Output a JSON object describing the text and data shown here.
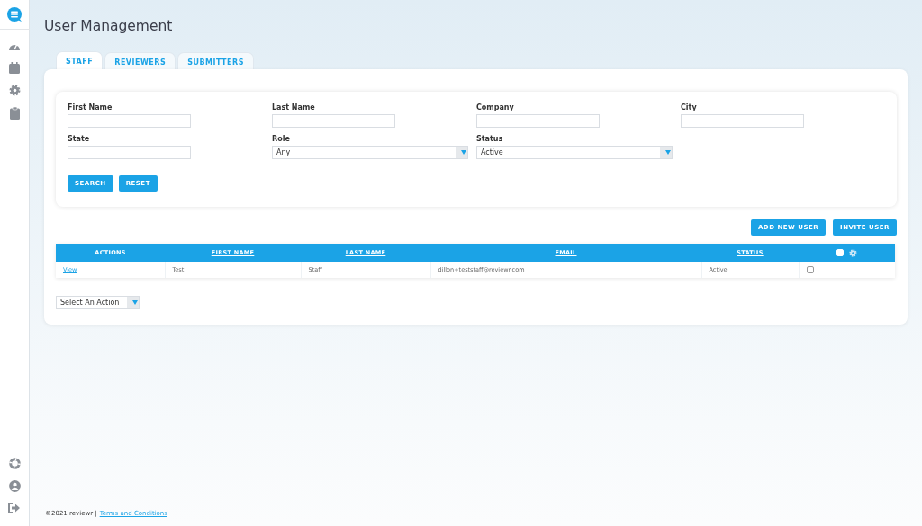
{
  "page_title": "User Management",
  "tabs": [
    {
      "label": "STAFF",
      "selected": true
    },
    {
      "label": "REVIEWERS",
      "selected": false
    },
    {
      "label": "SUBMITTERS",
      "selected": false
    }
  ],
  "filters": [
    {
      "kind": "text",
      "label": "First Name"
    },
    {
      "kind": "text",
      "label": "Last Name"
    },
    {
      "kind": "text",
      "label": "Company"
    },
    {
      "kind": "text",
      "label": "City"
    },
    {
      "kind": "text",
      "label": "State"
    },
    {
      "kind": "select",
      "label": "Role",
      "value": "Any"
    },
    {
      "kind": "select",
      "label": "Status",
      "value": "Active"
    }
  ],
  "filter_buttons": [
    "SEARCH",
    "RESET"
  ],
  "action_buttons": [
    "ADD NEW USER",
    "INVITE USER"
  ],
  "table": {
    "columns": [
      {
        "label": "ACTIONS",
        "sortable": false
      },
      {
        "label": "FIRST NAME",
        "sortable": true
      },
      {
        "label": "LAST NAME",
        "sortable": true
      },
      {
        "label": "EMAIL",
        "sortable": true
      },
      {
        "label": "STATUS",
        "sortable": true
      }
    ],
    "select_all": {
      "checked": false
    },
    "rows": [
      {
        "action": "View",
        "first_name": "Test",
        "last_name": "Staff",
        "email": "dillon+teststaff@reviewr.com",
        "status": "Active",
        "checked": false
      }
    ]
  },
  "bulk_action": {
    "value": "Select An Action"
  },
  "footer": {
    "copyright": "©2021 reviewr |",
    "link": "Terms and Conditions"
  }
}
